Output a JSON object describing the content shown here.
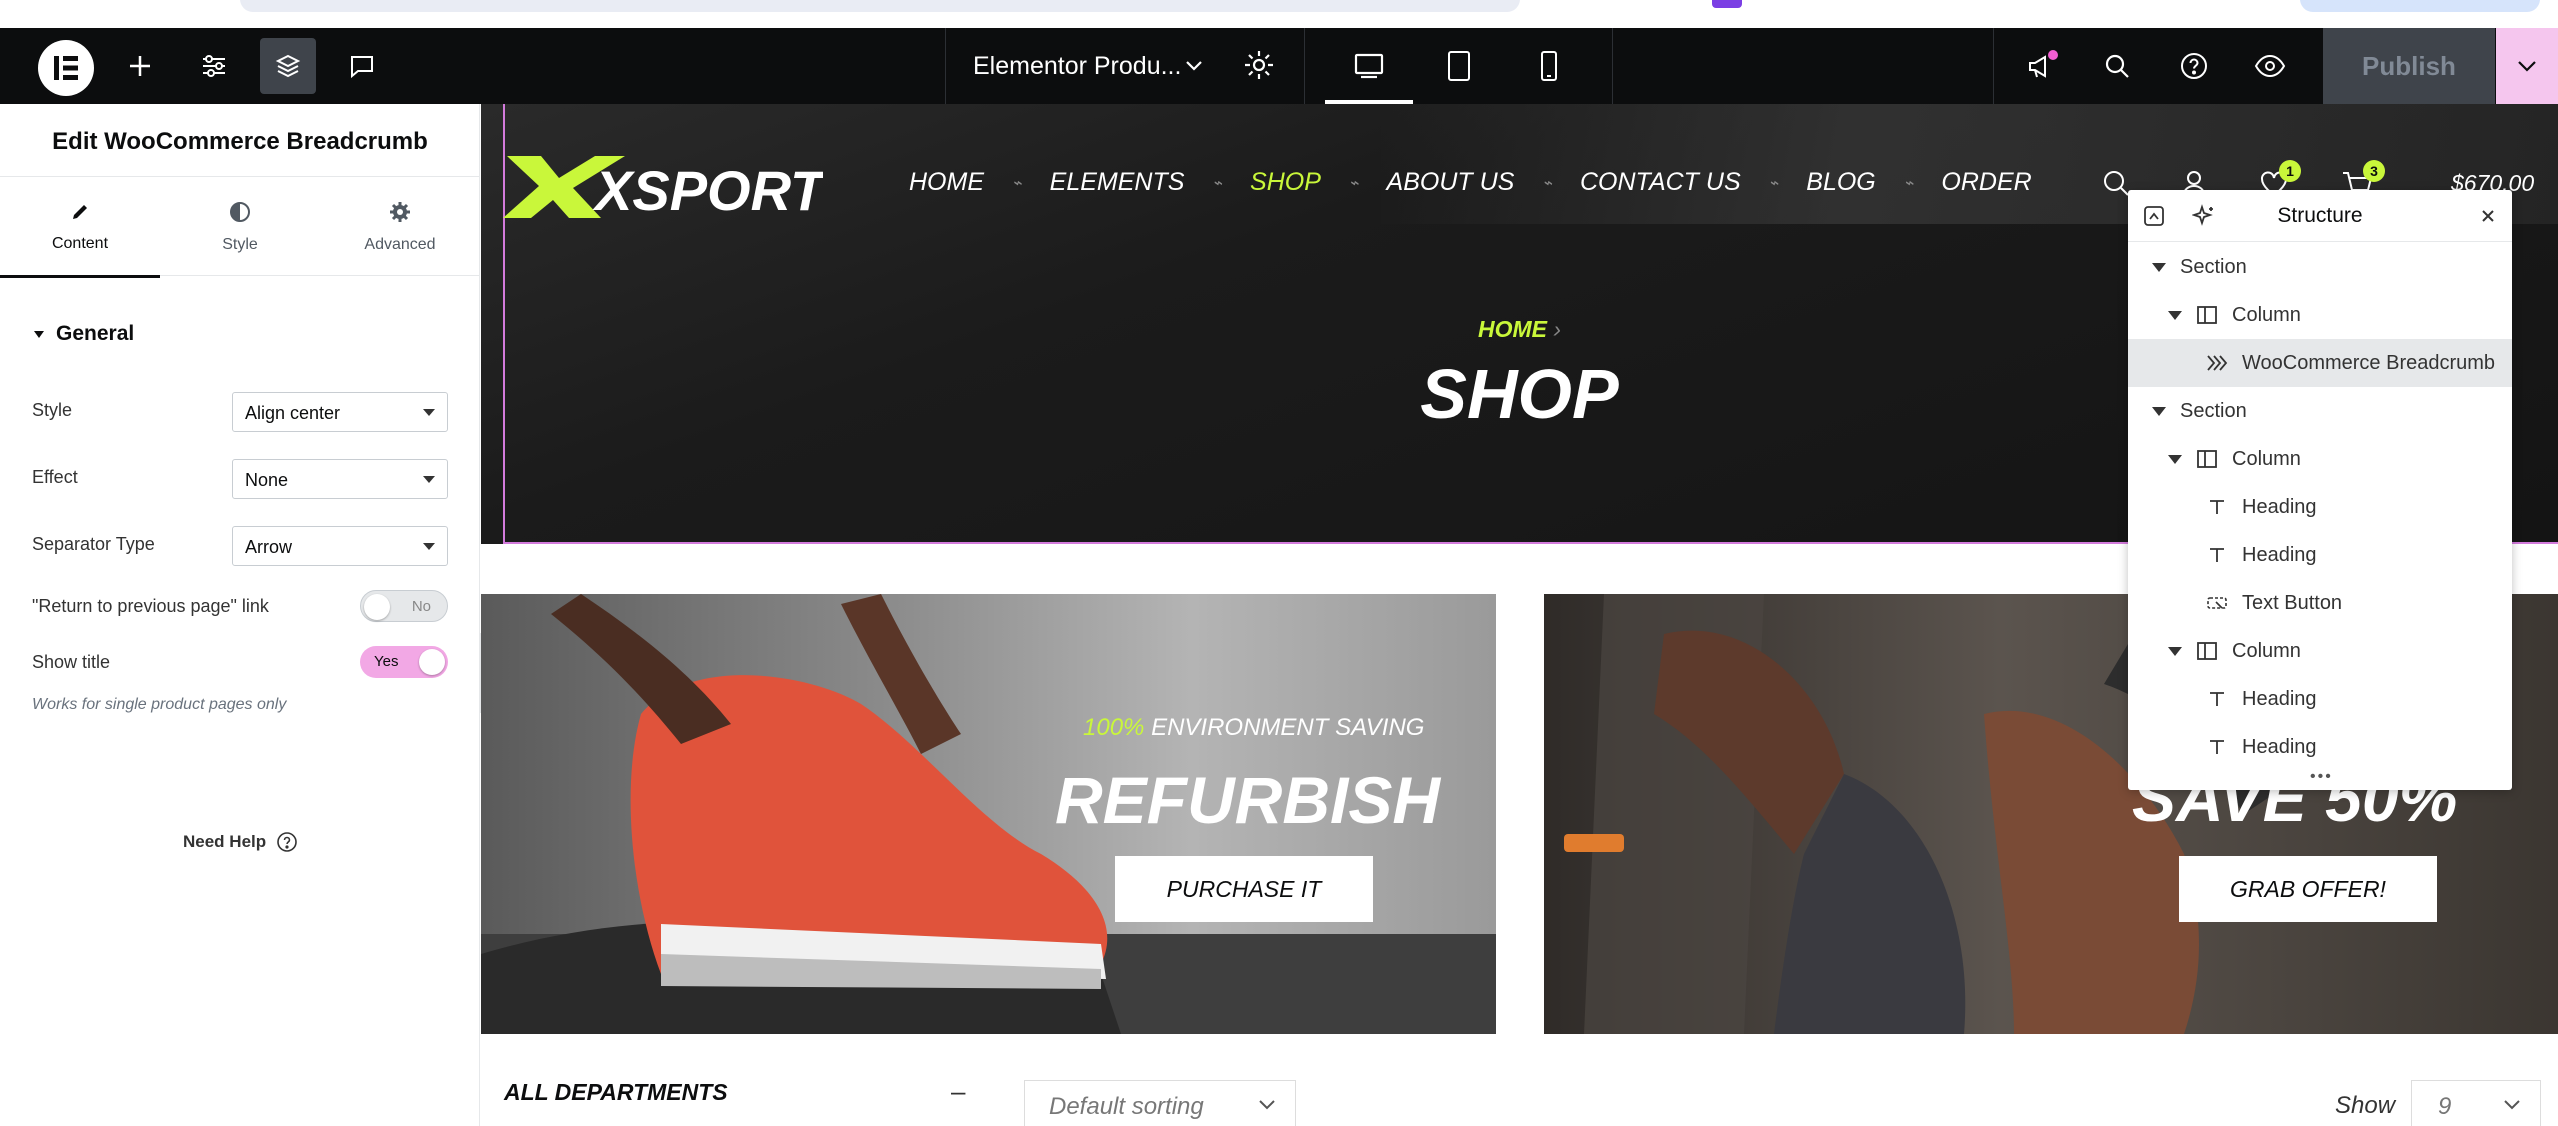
{
  "topbar": {
    "page_title": "Elementor Produ...",
    "publish_label": "Publish"
  },
  "panel": {
    "title": "Edit WooCommerce Breadcrumb",
    "tabs": [
      {
        "label": "Content",
        "icon": "pencil-icon"
      },
      {
        "label": "Style",
        "icon": "half-circle-icon"
      },
      {
        "label": "Advanced",
        "icon": "gear-icon"
      }
    ],
    "section_title": "General",
    "controls": {
      "style_label": "Style",
      "style_value": "Align center",
      "effect_label": "Effect",
      "effect_value": "None",
      "separator_label": "Separator Type",
      "separator_value": "Arrow",
      "return_label": "\"Return to previous page\" link",
      "return_value": "No",
      "show_title_label": "Show title",
      "show_title_value": "Yes"
    },
    "hint": "Works for single product pages only",
    "need_help": "Need Help"
  },
  "site": {
    "logo_text": "XSPORT",
    "nav": [
      "HOME",
      "ELEMENTS",
      "SHOP",
      "ABOUT US",
      "CONTACT US",
      "BLOG",
      "ORDER"
    ],
    "wishlist_count": "1",
    "cart_count": "3",
    "cart_total": "$670.00",
    "breadcrumb_home": "HOME",
    "breadcrumb_sep": "›",
    "page_heading": "SHOP",
    "accent_color": "#c9f73a"
  },
  "banners": [
    {
      "highlight": "100%",
      "small_heading": "ENVIRONMENT SAVING",
      "big_heading": "REFURBISH",
      "cta": "PURCHASE IT"
    },
    {
      "big_heading": "SAVE 50%",
      "cta": "GRAB OFFER!"
    }
  ],
  "shop": {
    "departments": "ALL DEPARTMENTS",
    "dep_toggle": "–",
    "sorting": "Default sorting",
    "show_label": "Show",
    "show_value": "9"
  },
  "structure": {
    "title": "Structure",
    "items": [
      {
        "label": "Section",
        "type": "section"
      },
      {
        "label": "Column",
        "type": "column"
      },
      {
        "label": "WooCommerce Breadcrumb",
        "type": "widget-breadcrumb"
      },
      {
        "label": "Section",
        "type": "section"
      },
      {
        "label": "Column",
        "type": "column"
      },
      {
        "label": "Heading",
        "type": "widget-heading"
      },
      {
        "label": "Heading",
        "type": "widget-heading"
      },
      {
        "label": "Text Button",
        "type": "widget-button"
      },
      {
        "label": "Column",
        "type": "column"
      },
      {
        "label": "Heading",
        "type": "widget-heading"
      },
      {
        "label": "Heading",
        "type": "widget-heading"
      }
    ],
    "resize_handle": "•••"
  }
}
